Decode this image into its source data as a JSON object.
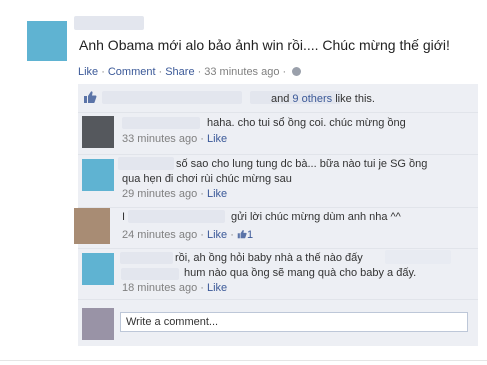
{
  "post": {
    "text": "Anh Obama mới alo bảo ảnh win rồi.... Chúc mừng thế giới!",
    "actions": {
      "like": "Like",
      "comment": "Comment",
      "share": "Share",
      "time": "33 minutes ago"
    }
  },
  "likes": {
    "and": "and",
    "others": "9 others",
    "suffix": "like this."
  },
  "comments": [
    {
      "text_lines": [
        "haha. cho tui sổ ồng coi. chúc mừng ồng"
      ],
      "time": "33 minutes ago",
      "like": "Like"
    },
    {
      "text_lines": [
        "số sao cho lung tung dc bà... bữa nào tui je SG ồng",
        "qua hẹn đi chơi rùi chúc mừng sau"
      ],
      "time": "29 minutes ago",
      "like": "Like"
    },
    {
      "text_lines": [
        "I",
        "gửi lời chúc mừng dùm anh nha ^^"
      ],
      "time": "24 minutes ago",
      "like": "Like",
      "like_count": "1"
    },
    {
      "text_lines": [
        "rồi, ah ồng hỏi baby nhà a thế nào đấy",
        "hum nào qua ồng sẽ mang quà cho baby a đấy."
      ],
      "time": "18 minutes ago",
      "like": "Like"
    }
  ],
  "composer": {
    "placeholder": "Write a comment..."
  },
  "colors": {
    "link": "#3b5998",
    "panel": "#edeff4",
    "text": "#333333",
    "muted": "#808080"
  }
}
